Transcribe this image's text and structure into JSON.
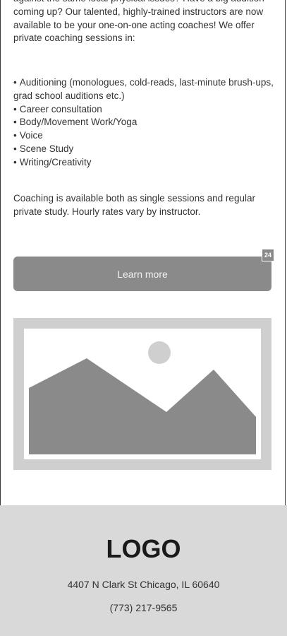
{
  "intro_text": "against the same local physical issues? Have a big audition coming up? Our talented, highly-trained instructors are now available to be your one-on-one acting coaches! We offer private coaching sessions in:",
  "bullets": [
    "Auditioning (monologues, cold-reads, last-minute brush-ups, grad school auditions etc.)",
    "Career consultation",
    "Body/Movement Work/Yoga",
    "Voice",
    "Scene Study",
    "Writing/Creativity"
  ],
  "outro_text": "Coaching is available both as single sessions and regular private study. Hourly rates vary by instructor.",
  "learn_more_label": "Learn more",
  "badge_count": "24",
  "image_icon": "image-placeholder-icon",
  "footer": {
    "logo": "LOGO",
    "address": "4407 N Clark St Chicago, IL 60640",
    "phone": "(773) 217-9565"
  },
  "colors": {
    "button": "#8a8a8a",
    "placeholder_frame": "#cfcfcf",
    "placeholder_shape": "#8a8a8a",
    "footer_bg": "#d9d9d9"
  }
}
